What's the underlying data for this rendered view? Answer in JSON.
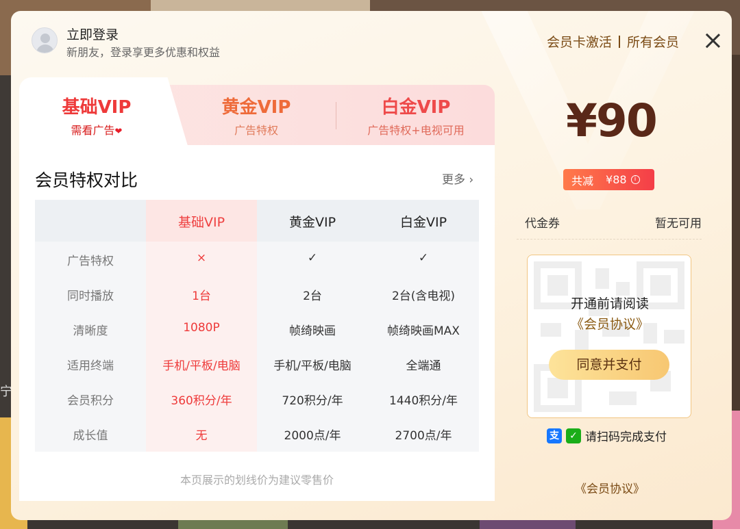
{
  "header": {
    "login_title": "立即登录",
    "login_subtitle": "新朋友，登录享更多优惠和权益",
    "card_activate": "会员卡激活",
    "all_members": "所有会员"
  },
  "tabs": [
    {
      "title": "基础VIP",
      "subtitle": "需看广告",
      "active": true
    },
    {
      "title": "黄金VIP",
      "subtitle": "广告特权",
      "active": false
    },
    {
      "title": "白金VIP",
      "subtitle": "广告特权+电视可用",
      "active": false
    }
  ],
  "comparison": {
    "title": "会员特权对比",
    "more": "更多",
    "columns": [
      "基础VIP",
      "黄金VIP",
      "白金VIP"
    ],
    "rows": [
      {
        "label": "广告特权",
        "values": [
          "×",
          "✓",
          "✓"
        ]
      },
      {
        "label": "同时播放",
        "values": [
          "1台",
          "2台",
          "2台(含电视)"
        ]
      },
      {
        "label": "清晰度",
        "values": [
          "1080P",
          "帧绮映画",
          "帧绮映画MAX"
        ]
      },
      {
        "label": "适用终端",
        "values": [
          "手机/平板/电脑",
          "手机/平板/电脑",
          "全端通"
        ]
      },
      {
        "label": "会员积分",
        "values": [
          "360积分/年",
          "720积分/年",
          "1440积分/年"
        ]
      },
      {
        "label": "成长值",
        "values": [
          "无",
          "2000点/年",
          "2700点/年"
        ]
      }
    ],
    "note": "本页展示的划线价为建议零售价"
  },
  "payment": {
    "price": "¥90",
    "discount_label": "共减",
    "discount_amount": "¥88",
    "coupon_label": "代金券",
    "coupon_value": "暂无可用",
    "qr_notice": "开通前请阅读",
    "qr_agreement": "《会员协议》",
    "pay_button": "同意并支付",
    "scan_text": "请扫码完成支付",
    "bottom_agreement": "《会员协议》"
  },
  "icons": {
    "alipay": "alipay-icon",
    "wechat": "wechat-pay-icon",
    "close": "close-icon"
  },
  "colors": {
    "accent_red": "#ee3a3a",
    "brown": "#7a4a14",
    "price": "#5a2818"
  },
  "background": {
    "peek_text": "宁"
  }
}
